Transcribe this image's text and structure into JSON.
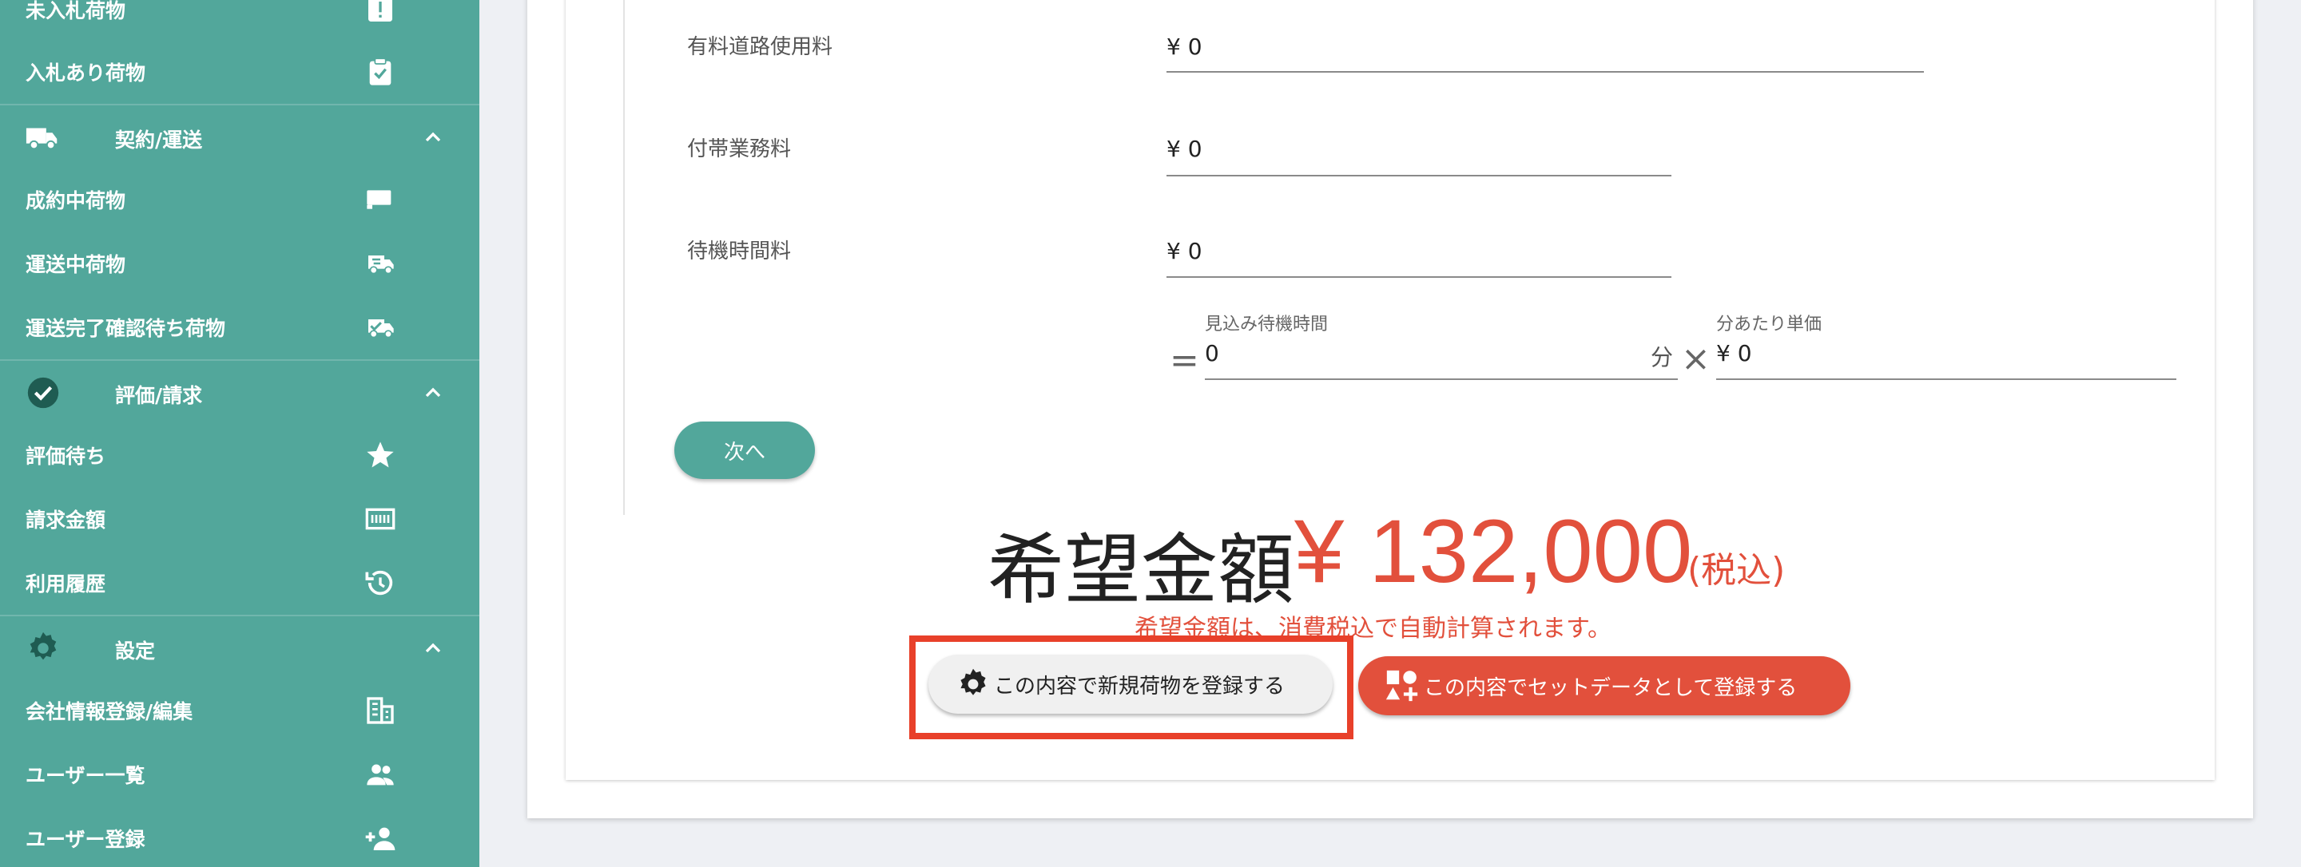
{
  "sidebar": {
    "items": [
      {
        "label": "未入札荷物",
        "icon": "alert-box-icon"
      },
      {
        "label": "入札あり荷物",
        "icon": "clipboard-check-icon"
      },
      {
        "label": "成約中荷物",
        "icon": "truck-icon"
      },
      {
        "label": "運送中荷物",
        "icon": "truck-fast-icon"
      },
      {
        "label": "運送完了確認待ち荷物",
        "icon": "truck-check-icon"
      },
      {
        "label": "評価待ち",
        "icon": "star-icon"
      },
      {
        "label": "請求金額",
        "icon": "invoice-icon"
      },
      {
        "label": "利用履歴",
        "icon": "history-icon"
      },
      {
        "label": "会社情報登録/編集",
        "icon": "building-icon"
      },
      {
        "label": "ユーザー一覧",
        "icon": "users-icon"
      },
      {
        "label": "ユーザー登録",
        "icon": "person-add-icon"
      }
    ],
    "sections": [
      {
        "label": "契約/運送",
        "icon": "truck-icon"
      },
      {
        "label": "評価/請求",
        "icon": "check-circle-icon"
      },
      {
        "label": "設定",
        "icon": "gear-icon"
      }
    ]
  },
  "form": {
    "toll_label": "有料道路使用料",
    "toll_value": "¥ 0",
    "incidental_label": "付帯業務料",
    "incidental_value": "¥ 0",
    "waiting_label": "待機時間料",
    "waiting_value": "¥ 0",
    "est_wait_label": "見込み待機時間",
    "est_wait_value": "0",
    "minutes_unit": "分",
    "unit_price_label": "分あたり単価",
    "unit_price_value": "¥ 0",
    "equals_sign": "=",
    "times_sign": "×",
    "next_label": "次へ"
  },
  "price": {
    "title": "希望金額",
    "value": "¥ 132,000",
    "tax": "(税込)",
    "note": "希望金額は、消費税込で自動計算されます。"
  },
  "actions": {
    "register_label": "この内容で新規荷物を登録する",
    "set_label": "この内容でセットデータとして登録する"
  },
  "colors": {
    "sidebar_bg": "#52a79b",
    "accent_red": "#e2503c",
    "highlight": "#e8402a"
  }
}
